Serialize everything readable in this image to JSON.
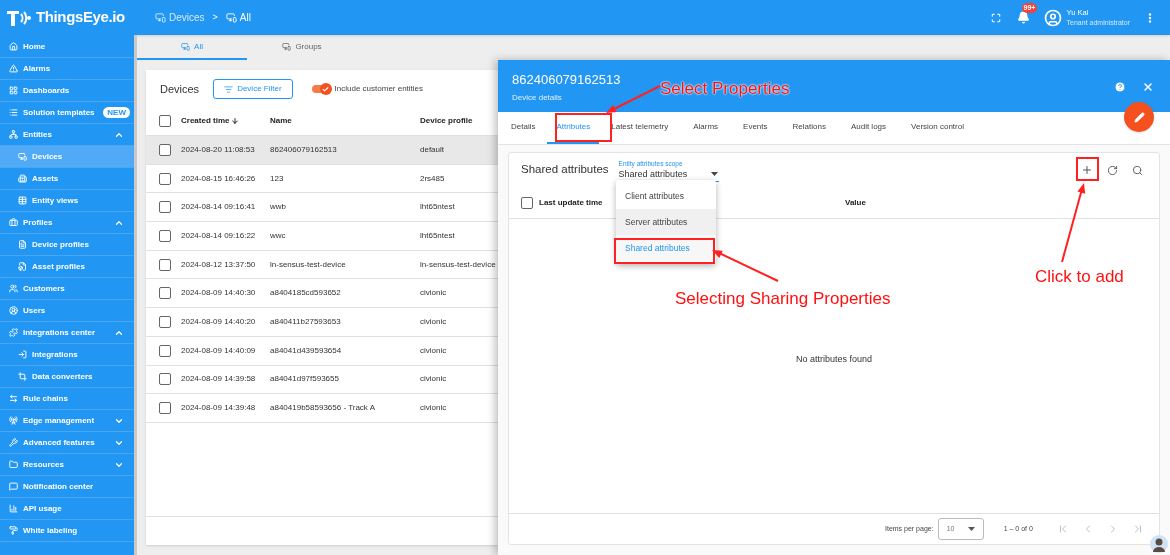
{
  "logo": {
    "text": "ThingsEye.io"
  },
  "breadcrumb": {
    "items": [
      {
        "label": "Devices"
      },
      {
        "label": "All"
      }
    ],
    "separator": ">"
  },
  "top_bar": {
    "notifications_badge": "99+",
    "user_name": "Yu Kai",
    "user_role": "Tenant administrator"
  },
  "sidebar": {
    "items": [
      {
        "label": "Home",
        "selected": false
      },
      {
        "label": "Alarms",
        "selected": false
      },
      {
        "label": "Dashboards",
        "selected": false
      },
      {
        "label": "Solution templates",
        "badge": "NEW",
        "selected": false
      },
      {
        "label": "Entities",
        "selected": false,
        "expanded": true,
        "children": [
          {
            "label": "Devices",
            "selected": true
          },
          {
            "label": "Assets",
            "selected": false
          },
          {
            "label": "Entity views",
            "selected": false
          }
        ]
      },
      {
        "label": "Profiles",
        "selected": false,
        "expanded": true,
        "children": [
          {
            "label": "Device profiles",
            "selected": false
          },
          {
            "label": "Asset profiles",
            "selected": false
          }
        ]
      },
      {
        "label": "Customers",
        "selected": false
      },
      {
        "label": "Users",
        "selected": false
      },
      {
        "label": "Integrations center",
        "selected": false,
        "expanded": true,
        "children": [
          {
            "label": "Integrations",
            "selected": false
          },
          {
            "label": "Data converters",
            "selected": false
          }
        ]
      },
      {
        "label": "Rule chains",
        "selected": false
      },
      {
        "label": "Edge management",
        "selected": false,
        "expanded": false
      },
      {
        "label": "Advanced features",
        "selected": false,
        "expanded": false
      },
      {
        "label": "Resources",
        "selected": false,
        "expanded": false
      },
      {
        "label": "Notification center",
        "selected": false
      },
      {
        "label": "API usage",
        "selected": false
      },
      {
        "label": "White labeling",
        "selected": false
      }
    ]
  },
  "view_tabs": [
    {
      "label": "All",
      "selected": true
    },
    {
      "label": "Groups",
      "selected": false
    }
  ],
  "devices": {
    "title": "Devices",
    "header_checked": false,
    "filter_button": "Device Filter",
    "include_customer_entities": {
      "label": "Include customer entities",
      "on": true
    },
    "columns": [
      {
        "label": "Created time",
        "sorted": true
      },
      {
        "label": "Name",
        "sorted": false
      },
      {
        "label": "Device profile",
        "sorted": false
      }
    ],
    "rows": [
      {
        "created": "2024-08-20 11:08:53",
        "name": "862406079162513",
        "profile": "default",
        "selected": true,
        "checked": false
      },
      {
        "created": "2024-08-15 16:46:26",
        "name": "123",
        "profile": "2rs485",
        "selected": false,
        "checked": false
      },
      {
        "created": "2024-08-14 09:16:41",
        "name": "wwb",
        "profile": "lht65ntest",
        "selected": false,
        "checked": false
      },
      {
        "created": "2024-08-14 09:16:22",
        "name": "wwc",
        "profile": "lht65ntest",
        "selected": false,
        "checked": false
      },
      {
        "created": "2024-08-12 13:37:50",
        "name": "ln-sensus-test-device",
        "profile": "ln-sensus-test-device",
        "selected": false,
        "checked": false
      },
      {
        "created": "2024-08-09 14:40:30",
        "name": "a8404185cd593652",
        "profile": "civionic",
        "selected": false,
        "checked": false
      },
      {
        "created": "2024-08-09 14:40:20",
        "name": "a840411b27593653",
        "profile": "civionic",
        "selected": false,
        "checked": false
      },
      {
        "created": "2024-08-09 14:40:09",
        "name": "a84041d439593654",
        "profile": "civionic",
        "selected": false,
        "checked": false
      },
      {
        "created": "2024-08-09 14:39:58",
        "name": "a84041d97f593655",
        "profile": "civionic",
        "selected": false,
        "checked": false
      },
      {
        "created": "2024-08-09 14:39:48",
        "name": "a840419b58593656 - Track A",
        "profile": "civionic",
        "selected": false,
        "checked": false
      }
    ]
  },
  "details_panel": {
    "title": "862406079162513",
    "subtitle": "Device details",
    "tabs": [
      {
        "label": "Details",
        "selected": false
      },
      {
        "label": "Attributes",
        "selected": true
      },
      {
        "label": "Latest telemetry",
        "selected": false
      },
      {
        "label": "Alarms",
        "selected": false
      },
      {
        "label": "Events",
        "selected": false
      },
      {
        "label": "Relations",
        "selected": false
      },
      {
        "label": "Audit logs",
        "selected": false
      },
      {
        "label": "Version control",
        "selected": false
      }
    ],
    "attributes": {
      "title": "Shared attributes",
      "scope": {
        "label": "Entity attributes scope",
        "value": "Shared attributes",
        "options": [
          {
            "label": "Client attributes",
            "selected": false,
            "highlighted": false
          },
          {
            "label": "Server attributes",
            "selected": false,
            "highlighted": true
          },
          {
            "label": "Shared attributes",
            "selected": true,
            "highlighted": false
          }
        ]
      },
      "header_checked": false,
      "columns": [
        {
          "label": "Last update time"
        },
        {
          "label": "Value"
        }
      ],
      "empty_message": "No attributes found",
      "paginator": {
        "items_per_page_label": "Items per page:",
        "page_size": "10",
        "range": "1 – 0 of 0"
      }
    }
  },
  "annotations": [
    {
      "text": "Select Properties"
    },
    {
      "text": "Selecting Sharing Properties"
    },
    {
      "text": "Click to add"
    }
  ]
}
